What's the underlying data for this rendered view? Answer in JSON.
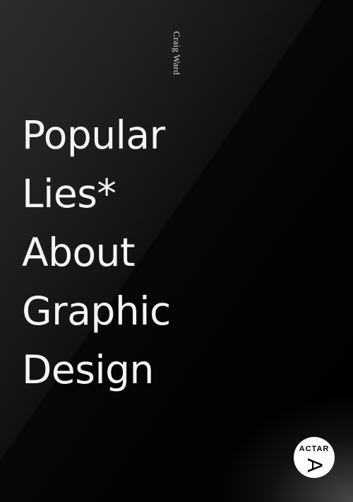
{
  "cover": {
    "author": "Craig Ward",
    "title_lines": [
      "Popular",
      "Lies*",
      "About",
      "Graphic",
      "Design"
    ],
    "publisher": {
      "name": "ACTAR",
      "logo_letter": "A"
    },
    "colors": {
      "background": "#000000",
      "text": "#f4f4f4",
      "badge_background": "#ffffff",
      "badge_text": "#000000"
    }
  }
}
